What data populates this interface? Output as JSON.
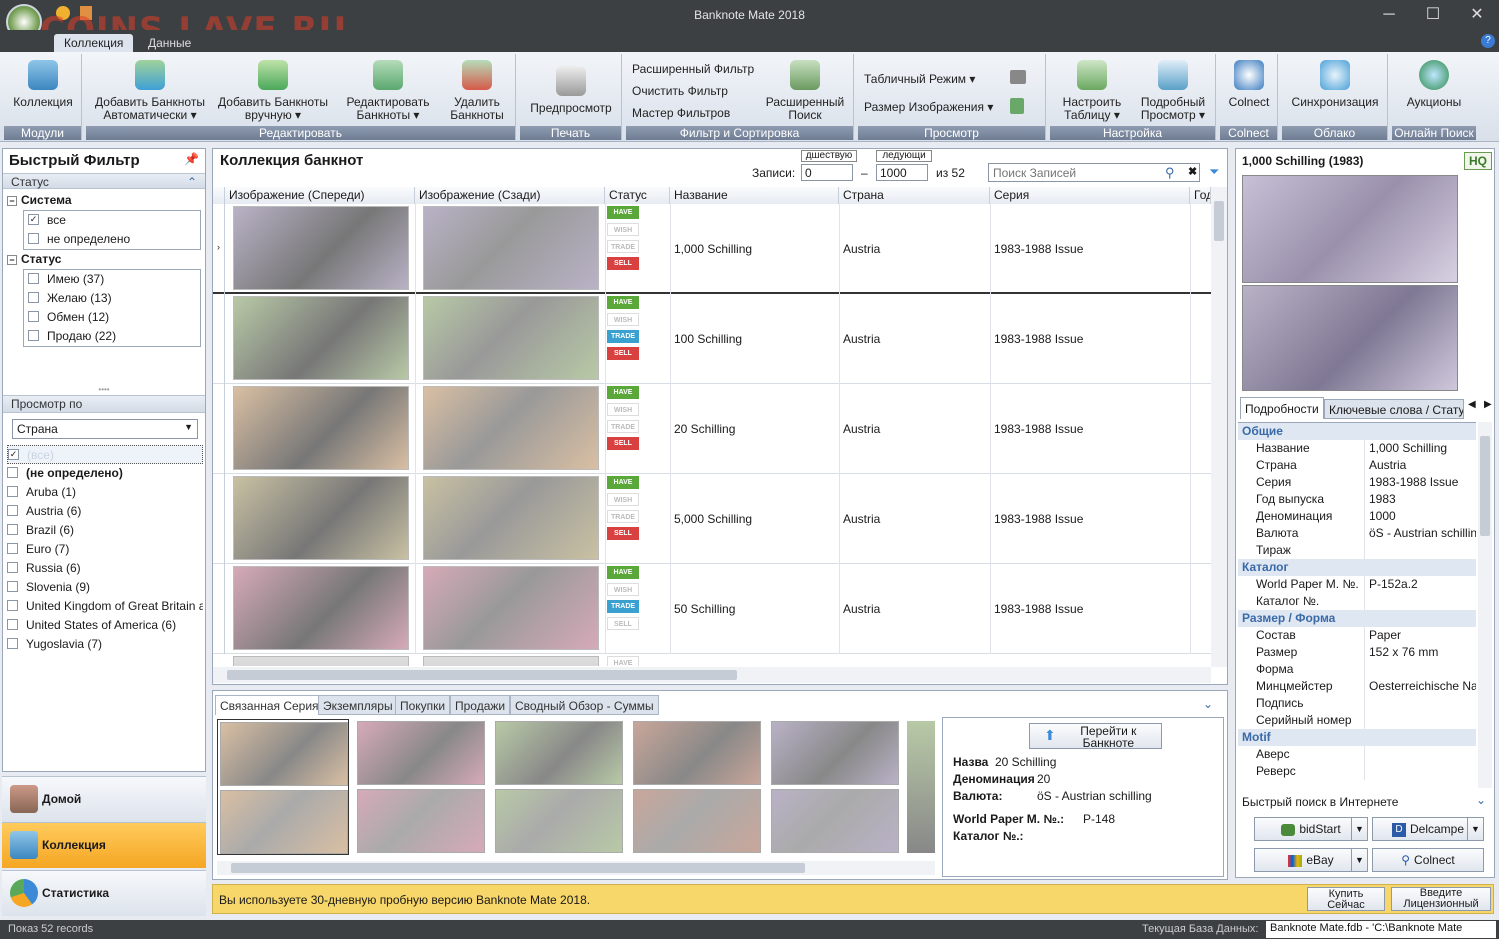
{
  "window": {
    "title": "Banknote Mate 2018",
    "watermark": "COINS.LAVE.RU"
  },
  "ribbon_tabs": [
    "Коллекция",
    "Данные"
  ],
  "ribbon": {
    "groups": [
      {
        "label": "Модули",
        "buttons": [
          "Коллекция"
        ]
      },
      {
        "label": "Редактировать",
        "buttons": [
          "Добавить Банкноты\nАвтоматически ▾",
          "Добавить Банкноты\nвручную ▾",
          "Редактировать\nБанкноты ▾",
          "Удалить\nБанкноты"
        ]
      },
      {
        "label": "Печать",
        "buttons": [
          "Предпросмотр"
        ]
      },
      {
        "label": "Фильтр и Сортировка",
        "buttons": [
          "Расширенный\nПоиск"
        ],
        "small": [
          "Расширенный Фильтр",
          "Очистить Фильтр",
          "Мастер Фильтров"
        ]
      },
      {
        "label": "Просмотр",
        "small": [
          "Табличный Режим",
          "Размер Изображения"
        ]
      },
      {
        "label": "Настройка",
        "buttons": [
          "Настроить\nТаблицу ▾",
          "Подробный\nПросмотр ▾"
        ]
      },
      {
        "label": "Colnect",
        "buttons": [
          "Colnect"
        ]
      },
      {
        "label": "Облако",
        "buttons": [
          "Синхронизация"
        ]
      },
      {
        "label": "Онлайн Поиск",
        "buttons": [
          "Аукционы"
        ]
      }
    ]
  },
  "quick_filter": {
    "title": "Быстрый Фильтр",
    "status_header": "Статус",
    "system_label": "Система",
    "system_items": [
      {
        "label": "все",
        "checked": true
      },
      {
        "label": "не определено",
        "checked": false
      }
    ],
    "status_label": "Статус",
    "status_items": [
      "Имею (37)",
      "Желаю (13)",
      "Обмен (12)",
      "Продаю (22)"
    ],
    "view_by_label": "Просмотр по",
    "view_by_value": "Страна",
    "countries": [
      "(все)",
      "(не определено)",
      "Aruba  (1)",
      "Austria  (6)",
      "Brazil  (6)",
      "Euro  (7)",
      "Russia  (6)",
      "Slovenia  (9)",
      "United Kingdom of Great Britain a",
      "United States of America  (6)",
      "Yugoslavia  (7)"
    ]
  },
  "nav": [
    "Домой",
    "Коллекция",
    "Статистика"
  ],
  "main": {
    "title": "Коллекция банкнот",
    "records_label": "Записи:",
    "prev_label": "дшествую",
    "next_label": "ледующи",
    "from": "0",
    "to": "1000",
    "of": "из 52",
    "search_placeholder": "Поиск Записей",
    "columns": [
      "Изображение (Спереди)",
      "Изображение (Сзади)",
      "Статус",
      "Название",
      "Страна",
      "Серия",
      "Год"
    ],
    "rows": [
      {
        "name": "1,000 Schilling",
        "country": "Austria",
        "series": "1983-1988 Issue",
        "color": "#b9b2c6",
        "trade": false,
        "sell": true
      },
      {
        "name": "100 Schilling",
        "country": "Austria",
        "series": "1983-1988 Issue",
        "color": "#b8c9a6",
        "trade": true,
        "sell": true
      },
      {
        "name": "20 Schilling",
        "country": "Austria",
        "series": "1983-1988 Issue",
        "color": "#d9bfa3",
        "trade": false,
        "sell": true
      },
      {
        "name": "5,000 Schilling",
        "country": "Austria",
        "series": "1983-1988 Issue",
        "color": "#c9c1a3",
        "trade": false,
        "sell": true
      },
      {
        "name": "50 Schilling",
        "country": "Austria",
        "series": "1983-1988 Issue",
        "color": "#d6aab8",
        "trade": true,
        "sell": false
      }
    ],
    "badges": {
      "have": "HAVE",
      "wish": "WISH",
      "trade": "TRADE",
      "sell": "SELL"
    }
  },
  "bottom": {
    "tabs": [
      "Связанная Серия",
      "Экземпляры",
      "Покупки",
      "Продажи",
      "Сводный Обзор - Суммы"
    ],
    "goto_label": "Перейти к\nБанкноте",
    "thumb_colors": [
      "#d9bfa3",
      "#d6aab8",
      "#b8c9a6",
      "#c9a69a",
      "#b9b2c6"
    ],
    "details": [
      {
        "k": "Назва",
        "v": "20 Schilling"
      },
      {
        "k": "Деноминация",
        "v": "20"
      },
      {
        "k": "Валюта:",
        "v": "öS - Austrian schilling"
      },
      {
        "k": "World Paper M. №.:",
        "v": "P-148"
      },
      {
        "k": "Каталог №.:",
        "v": ""
      }
    ]
  },
  "right": {
    "title": "1,000 Schilling (1983)",
    "hq": "HQ",
    "tabs": [
      "Подробности",
      "Ключевые слова / Статус"
    ],
    "props": [
      {
        "cat": "Общие"
      },
      {
        "k": "Название",
        "v": "1,000 Schilling"
      },
      {
        "k": "Страна",
        "v": "Austria"
      },
      {
        "k": "Серия",
        "v": "1983-1988 Issue"
      },
      {
        "k": "Год выпуска",
        "v": "1983"
      },
      {
        "k": "Деноминация",
        "v": "1000"
      },
      {
        "k": "Валюта",
        "v": "öS - Austrian schillin"
      },
      {
        "k": "Тираж",
        "v": ""
      },
      {
        "cat": "Каталог"
      },
      {
        "k": "World Paper M. №.",
        "v": "P-152a.2"
      },
      {
        "k": "Каталог №.",
        "v": ""
      },
      {
        "cat": "Размер / Форма"
      },
      {
        "k": "Состав",
        "v": "Paper"
      },
      {
        "k": "Размер",
        "v": "152 x 76 mm"
      },
      {
        "k": "Форма",
        "v": ""
      },
      {
        "k": "Минцмейстер",
        "v": "Oesterreichische Nat"
      },
      {
        "k": "Подпись",
        "v": ""
      },
      {
        "k": "Серийный номер",
        "v": ""
      },
      {
        "cat": "Motif"
      },
      {
        "k": "Аверс",
        "v": ""
      },
      {
        "k": "Реверс",
        "v": ""
      }
    ],
    "web_search_label": "Быстрый поиск в Интернете",
    "web_buttons": [
      "bidStart",
      "Delcampe",
      "eBay",
      "Colnect"
    ]
  },
  "trial": {
    "text": "Вы используете 30-дневную пробную версию Banknote Mate 2018.",
    "buy": "Купить\nСейчас",
    "license": "Введите\nЛицензионный\nКлюч"
  },
  "status": {
    "left": "Показ 52 records",
    "db_label": "Текущая База Данных:",
    "db_value": "Banknote Mate.fdb - 'C:\\Banknote Mate"
  }
}
